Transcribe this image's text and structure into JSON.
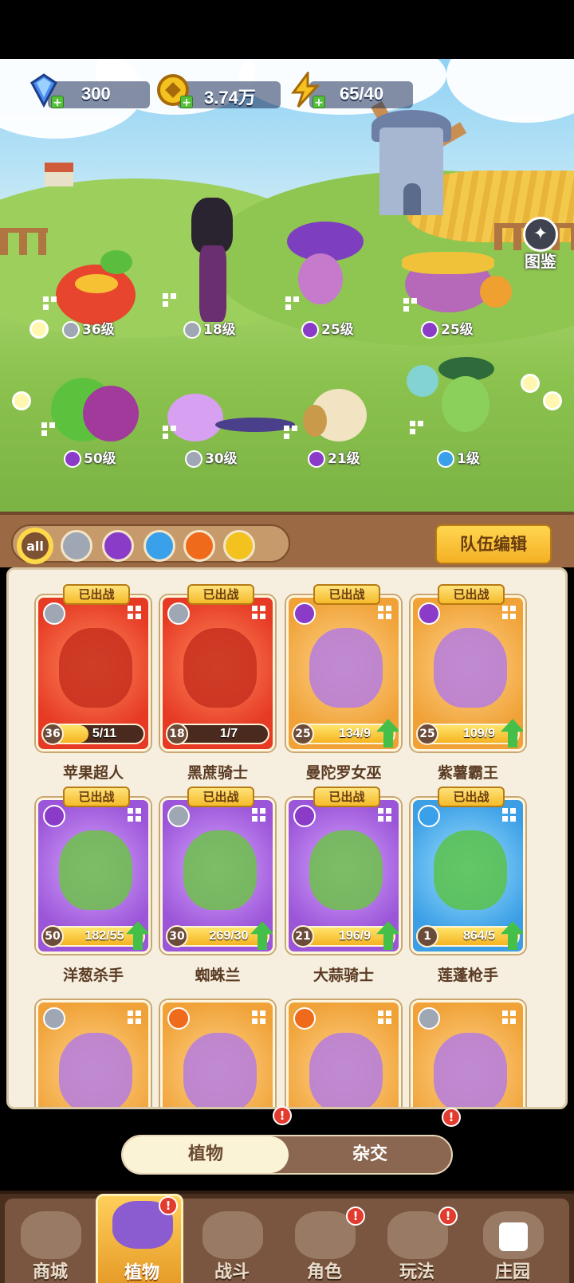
{
  "resources": [
    {
      "icon": "gem-icon",
      "value": "300"
    },
    {
      "icon": "gold-coin-icon",
      "value": "3.74万"
    },
    {
      "icon": "energy-bolt-icon",
      "value": "65/40"
    }
  ],
  "tujian_label": "图鉴",
  "scene_characters": [
    {
      "level": "36级",
      "element": "sword"
    },
    {
      "level": "18级",
      "element": "sword"
    },
    {
      "level": "25级",
      "element": "potion"
    },
    {
      "level": "25级",
      "element": "potion"
    },
    {
      "level": "50级",
      "element": "potion"
    },
    {
      "level": "30级",
      "element": "sword"
    },
    {
      "level": "21级",
      "element": "potion"
    },
    {
      "level": "1级",
      "element": "water"
    }
  ],
  "filters": [
    {
      "label": "all",
      "icon": "all-filter-icon"
    },
    {
      "label": "",
      "icon": "sword-filter-icon"
    },
    {
      "label": "",
      "icon": "potion-filter-icon"
    },
    {
      "label": "",
      "icon": "water-filter-icon"
    },
    {
      "label": "",
      "icon": "fire-filter-icon"
    },
    {
      "label": "",
      "icon": "bolt-filter-icon"
    }
  ],
  "team_edit_label": "队伍编辑",
  "deployed_label": "已出战",
  "cards": [
    {
      "name": "苹果超人",
      "level": "36",
      "progress": "5/11",
      "fill": 0.45,
      "color": "red",
      "element": "sword",
      "deployed": true,
      "upgrade": false
    },
    {
      "name": "黑蔗骑士",
      "level": "18",
      "progress": "1/7",
      "fill": 0.14,
      "color": "red",
      "element": "sword",
      "deployed": true,
      "upgrade": false
    },
    {
      "name": "曼陀罗女巫",
      "level": "25",
      "progress": "134/9",
      "fill": 1,
      "color": "orange",
      "element": "potion",
      "deployed": true,
      "upgrade": true
    },
    {
      "name": "紫薯霸王",
      "level": "25",
      "progress": "109/9",
      "fill": 1,
      "color": "orange",
      "element": "potion",
      "deployed": true,
      "upgrade": true
    },
    {
      "name": "洋葱杀手",
      "level": "50",
      "progress": "182/55",
      "fill": 1,
      "color": "purple",
      "element": "potion",
      "deployed": true,
      "upgrade": true
    },
    {
      "name": "蜘蛛兰",
      "level": "30",
      "progress": "269/30",
      "fill": 1,
      "color": "purple",
      "element": "sword",
      "deployed": true,
      "upgrade": true
    },
    {
      "name": "大蒜骑士",
      "level": "21",
      "progress": "196/9",
      "fill": 1,
      "color": "purple",
      "element": "potion",
      "deployed": true,
      "upgrade": true
    },
    {
      "name": "莲蓬枪手",
      "level": "1",
      "progress": "864/5",
      "fill": 1,
      "color": "blue",
      "element": "water",
      "deployed": true,
      "upgrade": true
    },
    {
      "name": "",
      "level": "",
      "progress": "",
      "fill": 0,
      "color": "orange",
      "element": "sword",
      "deployed": false,
      "upgrade": false
    },
    {
      "name": "",
      "level": "",
      "progress": "",
      "fill": 0,
      "color": "orange",
      "element": "fire",
      "deployed": false,
      "upgrade": false
    },
    {
      "name": "",
      "level": "",
      "progress": "",
      "fill": 0,
      "color": "orange",
      "element": "fire",
      "deployed": false,
      "upgrade": false
    },
    {
      "name": "",
      "level": "",
      "progress": "",
      "fill": 0,
      "color": "orange",
      "element": "sword",
      "deployed": false,
      "upgrade": false
    }
  ],
  "toggle": {
    "plants": "植物",
    "hybrid": "杂交",
    "alert": "!"
  },
  "nav": [
    {
      "label": "商城",
      "icon": "shop-icon",
      "alert": false
    },
    {
      "label": "植物",
      "icon": "plants-icon",
      "alert": true,
      "active": true
    },
    {
      "label": "战斗",
      "icon": "battle-icon",
      "alert": false
    },
    {
      "label": "角色",
      "icon": "character-icon",
      "alert": true
    },
    {
      "label": "玩法",
      "icon": "gameplay-icon",
      "alert": true
    },
    {
      "label": "庄园",
      "icon": "manor-icon",
      "alert": false,
      "locked": true
    }
  ],
  "colors": {
    "sword": "#9ea7b3",
    "potion": "#8a3cc9",
    "water": "#3ba0ea",
    "fire": "#f06a1c",
    "bolt": "#f4c21f"
  }
}
